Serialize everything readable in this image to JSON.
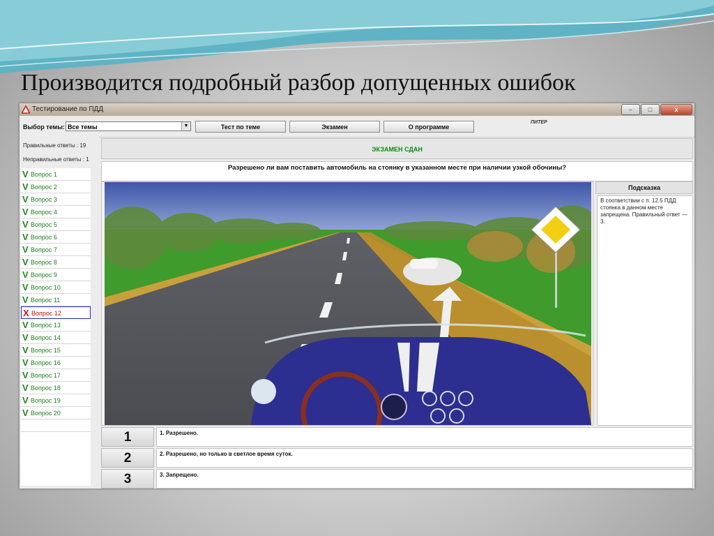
{
  "slide": {
    "title": "Производится подробный разбор допущенных ошибок"
  },
  "window": {
    "title": "Тестирование по ПДД",
    "controls": {
      "minimize": "–",
      "maximize": "□",
      "close": "x"
    }
  },
  "toolbar": {
    "theme_label": "Выбор темы:",
    "theme_value": "Все темы",
    "buttons": [
      "Тест по теме",
      "Экзамен",
      "О программе"
    ],
    "brand": "ПИТЕР"
  },
  "stats": {
    "correct": "Правильные ответы   : 19",
    "incorrect": "Неправильные ответы : 1"
  },
  "questions": [
    {
      "label": "Вопрос 1",
      "status": "correct"
    },
    {
      "label": "Вопрос 2",
      "status": "correct"
    },
    {
      "label": "Вопрос 3",
      "status": "correct"
    },
    {
      "label": "Вопрос 4",
      "status": "correct"
    },
    {
      "label": "Вопрос 5",
      "status": "correct"
    },
    {
      "label": "Вопрос 6",
      "status": "correct"
    },
    {
      "label": "Вопрос 7",
      "status": "correct"
    },
    {
      "label": "Вопрос 8",
      "status": "correct"
    },
    {
      "label": "Вопрос 9",
      "status": "correct"
    },
    {
      "label": "Вопрос 10",
      "status": "correct"
    },
    {
      "label": "Вопрос 11",
      "status": "correct"
    },
    {
      "label": "Вопрос 12",
      "status": "wrong"
    },
    {
      "label": "Вопрос 13",
      "status": "correct"
    },
    {
      "label": "Вопрос 14",
      "status": "correct"
    },
    {
      "label": "Вопрос 15",
      "status": "correct"
    },
    {
      "label": "Вопрос 16",
      "status": "correct"
    },
    {
      "label": "Вопрос 17",
      "status": "correct"
    },
    {
      "label": "Вопрос 18",
      "status": "correct"
    },
    {
      "label": "Вопрос 19",
      "status": "correct"
    },
    {
      "label": "Вопрос 20",
      "status": "correct"
    }
  ],
  "marks": {
    "correct": "V",
    "wrong": "X"
  },
  "exam": {
    "status": "ЭКЗАМЕН СДАН",
    "question": "Разрешено ли вам поставить автомобиль на стоянку в указанном месте при наличии узкой обочины?"
  },
  "hint": {
    "title": "Подсказка",
    "text": "В соответствии с п. 12.5 ПДД стоянка в данном месте запрещена. Правильный ответ — 3."
  },
  "answers": [
    {
      "num": "1",
      "text": "1. Разрешено."
    },
    {
      "num": "2",
      "text": "2. Разрешено, но только в светлое время суток."
    },
    {
      "num": "3",
      "text": "3. Запрещено."
    }
  ],
  "colors": {
    "correct": "#1e8a1e",
    "wrong": "#d01010",
    "status_ok": "#0b8a0b"
  }
}
